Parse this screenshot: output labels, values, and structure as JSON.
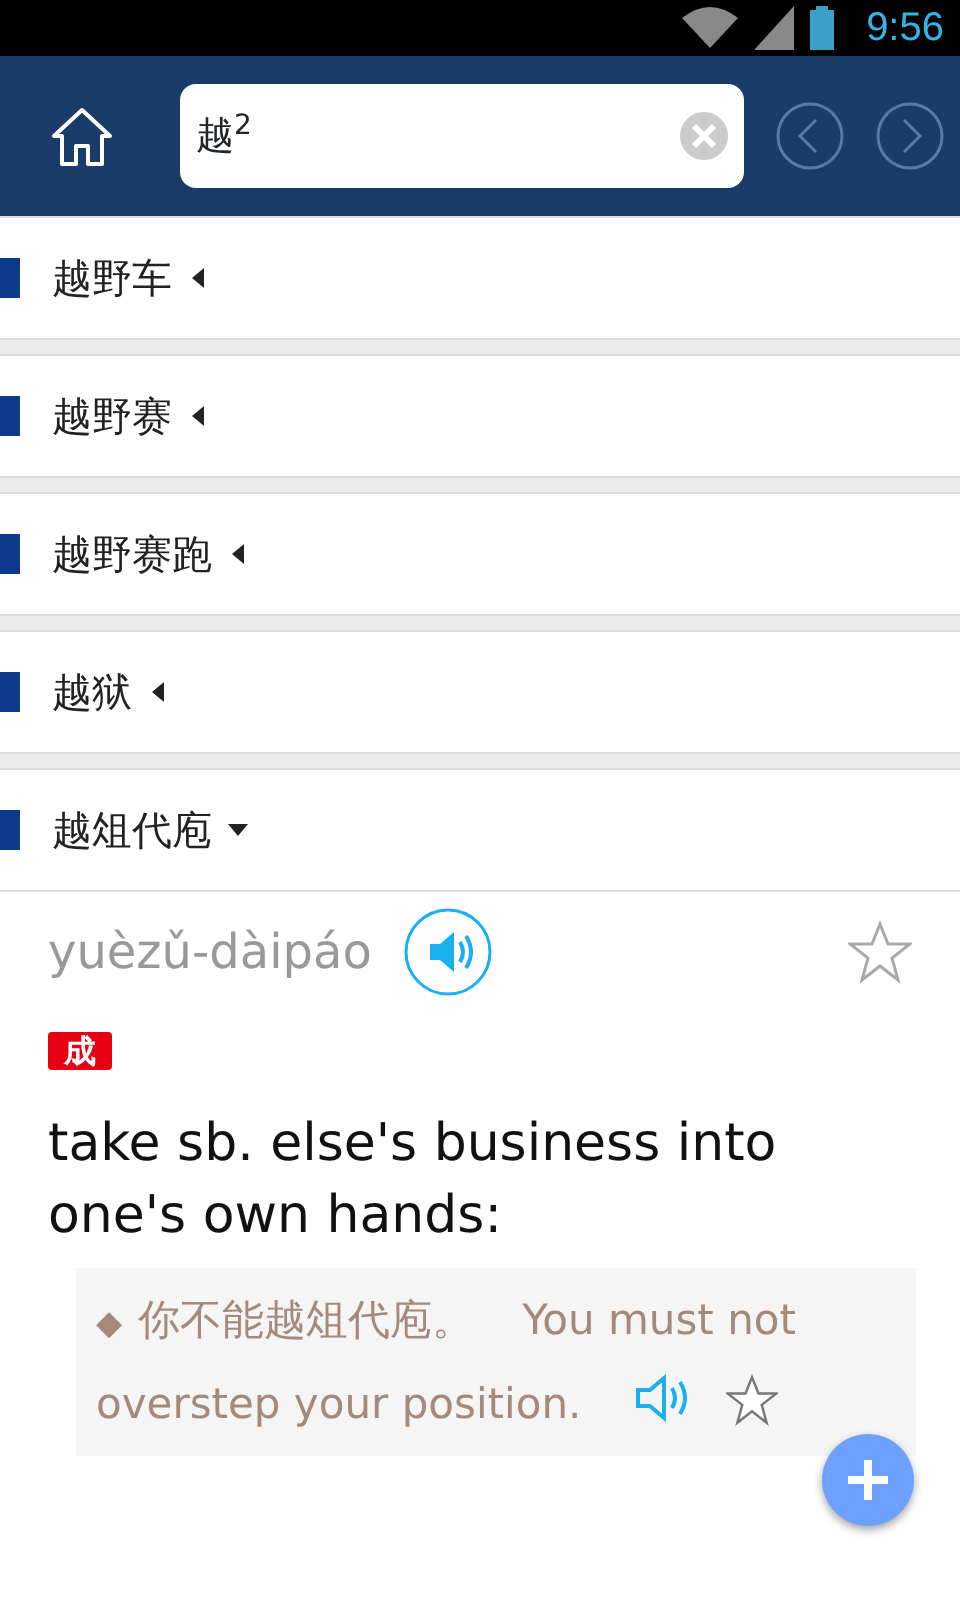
{
  "status_bar": {
    "time": "9:56"
  },
  "search": {
    "value": "越$^{2}$"
  },
  "entries": [
    {
      "headword": "越野车",
      "expanded": false
    },
    {
      "headword": "越野赛",
      "expanded": false
    },
    {
      "headword": "越野赛跑",
      "expanded": false
    },
    {
      "headword": "越狱",
      "expanded": false
    },
    {
      "headword": "越俎代庖",
      "expanded": true,
      "pinyin": "yuèzǔ-dàipáo",
      "tag": "成",
      "definition": "take sb. else's business into one's own hands:",
      "example": {
        "bullet": "◆",
        "chinese": "你不能越俎代庖。",
        "english_lines": [
          "You must not",
          "overstep your position."
        ]
      }
    }
  ]
}
